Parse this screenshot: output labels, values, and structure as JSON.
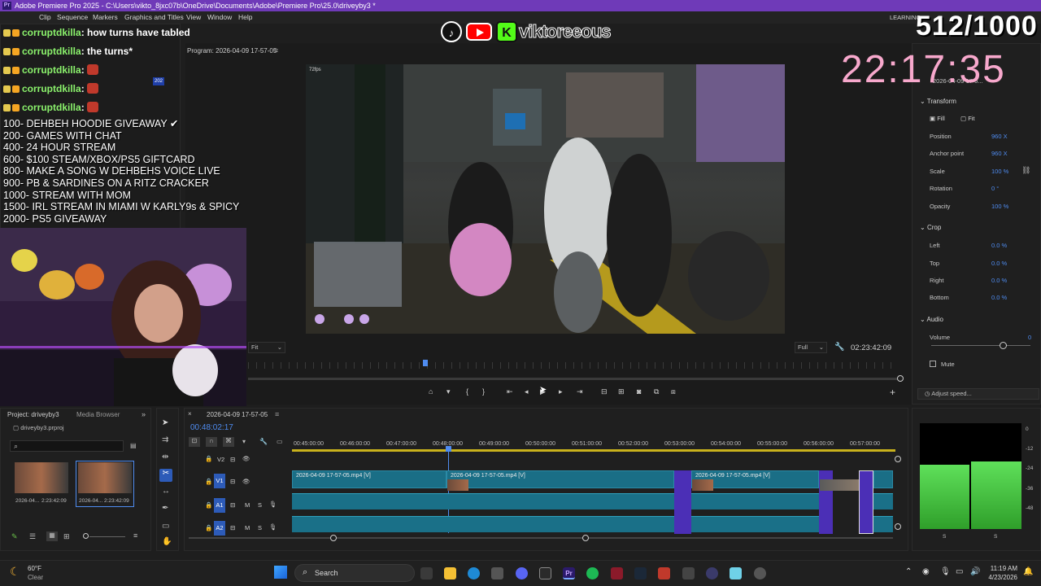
{
  "app": {
    "title": "Adobe Premiere Pro 2025 - C:\\Users\\vikto_8jxc07b\\OneDrive\\Documents\\Adobe\\Premiere Pro\\25.0\\driveyby3 *",
    "menu": [
      "Clip",
      "Sequence",
      "Markers",
      "Graphics and Titles",
      "View",
      "Window",
      "Help"
    ],
    "workspace": "LEARNING"
  },
  "overlay": {
    "social_handle": "viktoreeous",
    "counter": "512/1000",
    "clock": "22:17:35",
    "chat": [
      {
        "user": "corruptdkilla",
        "message": ": how turns have tabled"
      },
      {
        "user": "corruptdkilla",
        "message": ": the turns*"
      },
      {
        "user": "corruptdkilla",
        "message": ":"
      },
      {
        "user": "corruptdkilla",
        "message": ":"
      },
      {
        "user": "corruptdkilla",
        "message": ":"
      }
    ],
    "goals": [
      "100- DEHBEH HOODIE GIVEAWAY ✔",
      "200- GAMES WITH CHAT",
      "400- 24 HOUR STREAM",
      "600- $100 STEAM/XBOX/PS5 GIFTCARD",
      "800- MAKE A SONG W DEHBEHS VOICE LIVE",
      "900- PB & SARDINES ON A RITZ CRACKER",
      "1000- STREAM WITH MOM",
      "1500- IRL STREAM IN MIAMI W KARLY9s & SPICY",
      "2000- PS5 GIVEAWAY"
    ]
  },
  "program_monitor": {
    "title": "Program: 2026-04-09 17-57-05",
    "fit": "Fit",
    "resolution": "Full",
    "timecode": "02:23:42:09",
    "video_fps": "72fps"
  },
  "effect_controls": {
    "clip_name": "2026-04-09 17-5...",
    "sections": {
      "transform": "Transform",
      "fill": "Fill",
      "fit": "Fit",
      "crop": "Crop",
      "audio": "Audio",
      "mute": "Mute",
      "adjust_speed": "Adjust speed..."
    },
    "properties": [
      {
        "name": "Position",
        "value": "960 X"
      },
      {
        "name": "Anchor point",
        "value": "960 X"
      },
      {
        "name": "Scale",
        "value": "100 %"
      },
      {
        "name": "Rotation",
        "value": "0 °"
      },
      {
        "name": "Opacity",
        "value": "100 %"
      },
      {
        "name": "Left",
        "value": "0.0 %"
      },
      {
        "name": "Top",
        "value": "0.0 %"
      },
      {
        "name": "Right",
        "value": "0.0 %"
      },
      {
        "name": "Bottom",
        "value": "0.0 %"
      }
    ],
    "volume_label": "Volume",
    "volume_value": "0"
  },
  "project_panel": {
    "tabs": [
      "Project: driveyby3",
      "Media Browser"
    ],
    "project_file": "driveyby3.prproj",
    "items": [
      {
        "name": "2026-04...",
        "duration": "2:23:42:09"
      },
      {
        "name": "2026-04...",
        "duration": "2:23:42:09"
      }
    ]
  },
  "timeline": {
    "sequence_name": "2026-04-09 17-57-05",
    "playhead": "00:48:02:17",
    "ruler": [
      "00:45:00:00",
      "00:46:00:00",
      "00:47:00:00",
      "00:48:00:00",
      "00:49:00:00",
      "00:50:00:00",
      "00:51:00:00",
      "00:52:00:00",
      "00:53:00:00",
      "00:54:00:00",
      "00:55:00:00",
      "00:56:00:00",
      "00:57:00:00"
    ],
    "tracks": [
      "V2",
      "V1",
      "A1",
      "A2"
    ],
    "clip_label": "2026-04-09 17-57-05.mp4 [V]"
  },
  "audio_meter": {
    "scale": [
      "0",
      "-12",
      "-24",
      "-36",
      "-48"
    ],
    "channels": [
      "S",
      "S"
    ]
  },
  "taskbar": {
    "weather_temp": "60°F",
    "weather_desc": "Clear",
    "search_placeholder": "Search",
    "time": "11:19 AM",
    "date": "4/23/2026"
  }
}
